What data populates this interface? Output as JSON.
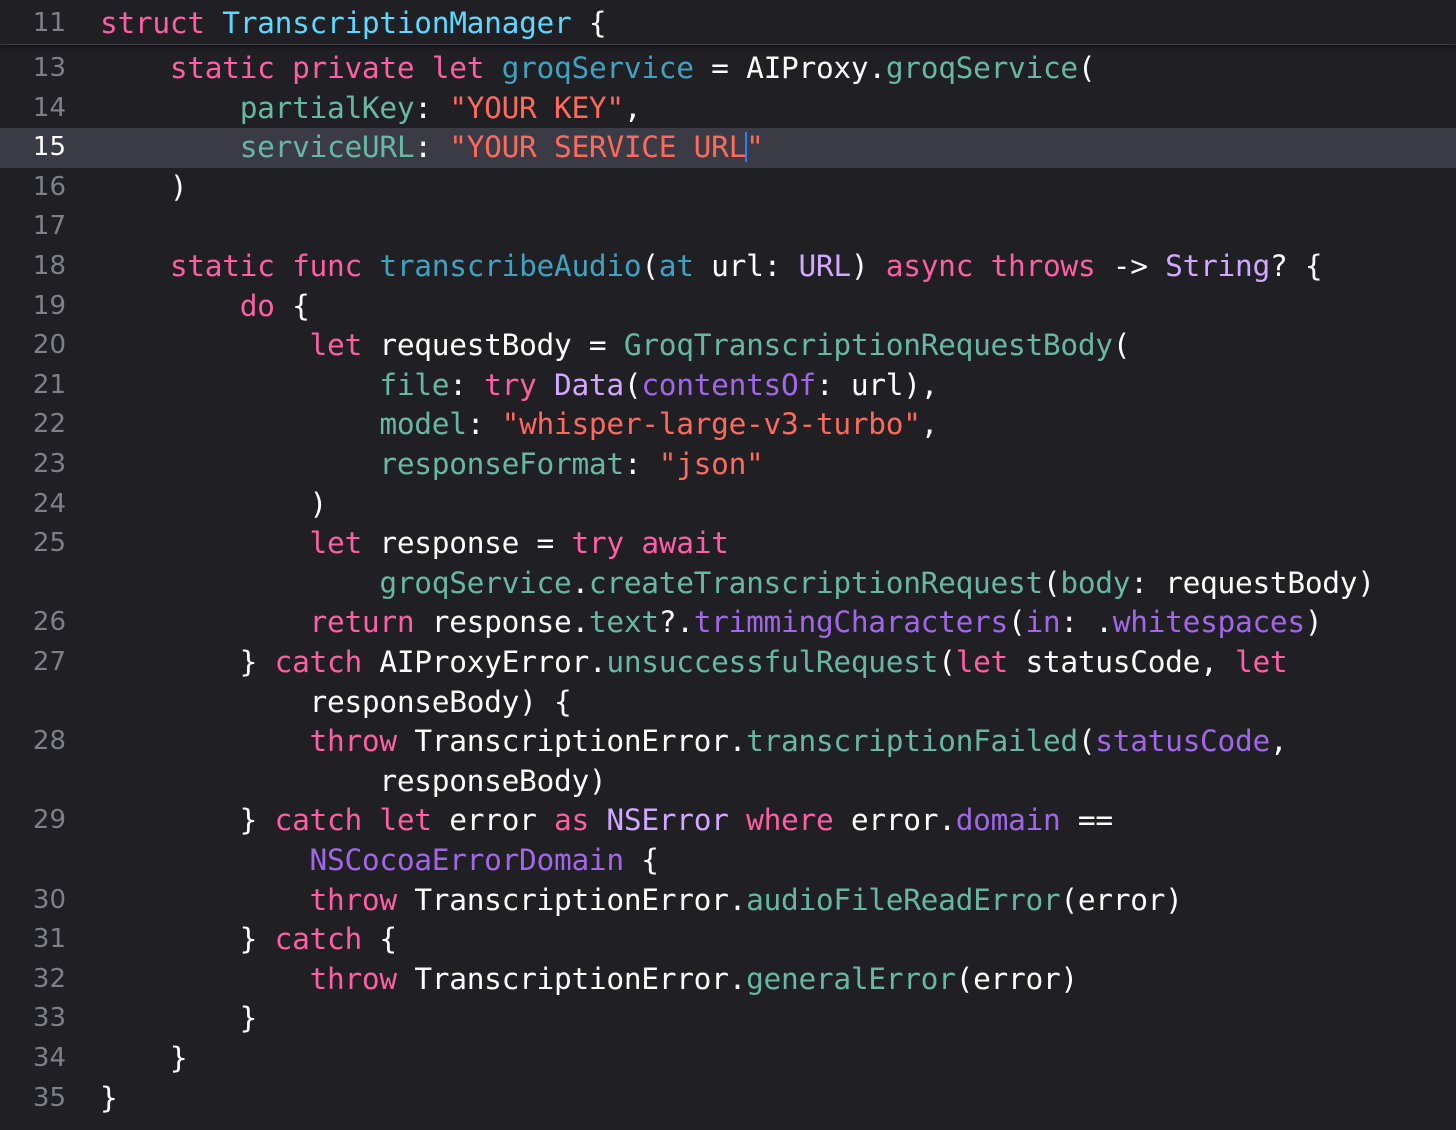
{
  "theme": {
    "background": "#1f1f24",
    "current_line": "#3a3b45",
    "keyword": "#fc5fa3",
    "type_declaration": "#5dd8ff",
    "other_type": "#d0a8ff",
    "function_declaration": "#41a1c0",
    "project_member": "#67b7a4",
    "other_member": "#a167e6",
    "string": "#fc6a5d",
    "plain_text": "#ffffff",
    "line_number": "#7f8086",
    "cursor": "#2f7cff"
  },
  "editor": {
    "current_line_number": "15",
    "line_numbers": {
      "n11": "11",
      "n13": "13",
      "n14": "14",
      "n15": "15",
      "n16": "16",
      "n17": "17",
      "n18": "18",
      "n19": "19",
      "n20": "20",
      "n21": "21",
      "n22": "22",
      "n23": "23",
      "n24": "24",
      "n25": "25",
      "n26": "26",
      "n27": "27",
      "n28": "28",
      "n29": "29",
      "n30": "30",
      "n31": "31",
      "n32": "32",
      "n33": "33",
      "n34": "34",
      "n35": "35"
    },
    "tokens": {
      "struct": "struct",
      "TranscriptionManager": "TranscriptionManager",
      "static": "static",
      "private": "private",
      "let": "let",
      "groqService": "groqService",
      "AIProxy": "AIProxy",
      "partialKey": "partialKey",
      "your_key": "\"YOUR KEY\"",
      "serviceURL": "serviceURL",
      "your_service_url_body": "\"YOUR SERVICE URL",
      "quote": "\"",
      "func": "func",
      "transcribeAudio": "transcribeAudio",
      "at": "at",
      "URL": "URL",
      "async": "async",
      "throws": "throws",
      "String": "String",
      "do": "do",
      "requestBody": "requestBody",
      "GroqTranscriptionRequestBody": "GroqTranscriptionRequestBody",
      "file": "file",
      "try": "try",
      "Data": "Data",
      "contentsOf": "contentsOf",
      "model": "model",
      "model_value": "\"whisper-large-v3-turbo\"",
      "responseFormat": "responseFormat",
      "json_value": "\"json\"",
      "response": "response",
      "await": "await",
      "createTranscriptionRequest": "createTranscriptionRequest",
      "body": "body",
      "return": "return",
      "text": "text",
      "trimmingCharacters": "trimmingCharacters",
      "in": "in",
      "whitespaces": "whitespaces",
      "catch": "catch",
      "AIProxyError": "AIProxyError",
      "unsuccessfulRequest": "unsuccessfulRequest",
      "statusCode": "statusCode",
      "responseBody": "responseBody",
      "throw": "throw",
      "TranscriptionError": "TranscriptionError",
      "transcriptionFailed": "transcriptionFailed",
      "error": "error",
      "as": "as",
      "NSError": "NSError",
      "where": "where",
      "domain": "domain",
      "NSCocoaErrorDomain": "NSCocoaErrorDomain",
      "audioFileReadError": "audioFileReadError",
      "generalError": "generalError"
    }
  }
}
